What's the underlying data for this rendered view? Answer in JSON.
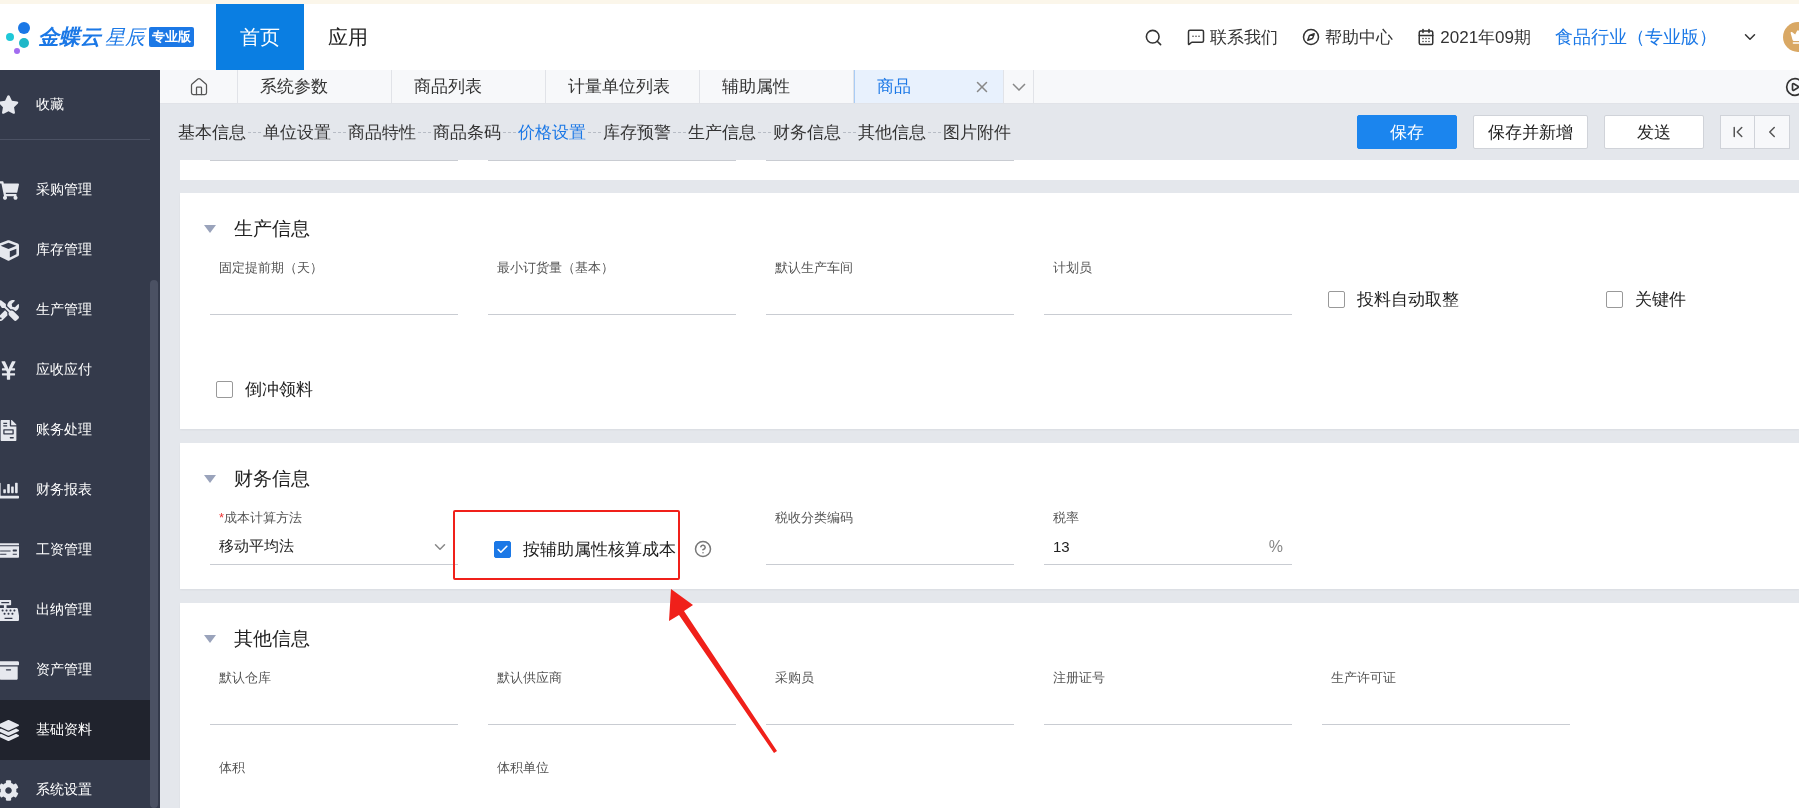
{
  "logo": {
    "brand": "金蝶云",
    "product": "星辰",
    "edition": "专业版"
  },
  "top_nav": [
    {
      "label": "首页",
      "selected": true
    },
    {
      "label": "应用",
      "selected": false
    }
  ],
  "header_actions": [
    {
      "label": "联系我们"
    },
    {
      "label": "帮助中心"
    },
    {
      "label": "2021年09期"
    }
  ],
  "account": {
    "label": "食品行业（专业版）"
  },
  "sidebar": {
    "items": [
      {
        "label": "收藏",
        "selected": false
      },
      {
        "label": "采购管理",
        "selected": false
      },
      {
        "label": "库存管理",
        "selected": false
      },
      {
        "label": "生产管理",
        "selected": false
      },
      {
        "label": "应收应付",
        "selected": false
      },
      {
        "label": "账务处理",
        "selected": false
      },
      {
        "label": "财务报表",
        "selected": false
      },
      {
        "label": "工资管理",
        "selected": false
      },
      {
        "label": "出纳管理",
        "selected": false
      },
      {
        "label": "资产管理",
        "selected": false
      },
      {
        "label": "基础资料",
        "selected": true
      },
      {
        "label": "系统设置",
        "selected": false
      }
    ]
  },
  "tabs": [
    {
      "label": "系统参数",
      "selected": false
    },
    {
      "label": "商品列表",
      "selected": false
    },
    {
      "label": "计量单位列表",
      "selected": false
    },
    {
      "label": "辅助属性",
      "selected": false
    },
    {
      "label": "商品",
      "selected": true
    }
  ],
  "anchors": [
    {
      "label": "基本信息",
      "selected": false
    },
    {
      "label": "单位设置",
      "selected": false
    },
    {
      "label": "商品特性",
      "selected": false
    },
    {
      "label": "商品条码",
      "selected": false
    },
    {
      "label": "价格设置",
      "selected": true
    },
    {
      "label": "库存预警",
      "selected": false
    },
    {
      "label": "生产信息",
      "selected": false
    },
    {
      "label": "财务信息",
      "selected": false
    },
    {
      "label": "其他信息",
      "selected": false
    },
    {
      "label": "图片附件",
      "selected": false
    }
  ],
  "actions": [
    {
      "label": "保存",
      "kind": "primary"
    },
    {
      "label": "保存并新增",
      "kind": "default"
    },
    {
      "label": "发送",
      "kind": "default"
    }
  ],
  "sections": [
    {
      "title": "生产信息",
      "expanded": true,
      "fields": [
        {
          "kind": "text",
          "label": "固定提前期（天）"
        },
        {
          "kind": "text",
          "label": "最小订货量（基本）"
        },
        {
          "kind": "text",
          "label": "默认生产车间"
        },
        {
          "kind": "text",
          "label": "计划员"
        },
        {
          "kind": "checkbox",
          "label": "投料自动取整",
          "checked": false
        },
        {
          "kind": "checkbox",
          "label": "关键件",
          "checked": false
        },
        {
          "kind": "checkbox",
          "label": "倒冲领料",
          "checked": false
        }
      ]
    },
    {
      "title": "财务信息",
      "expanded": true,
      "fields": [
        {
          "kind": "select",
          "label": "成本计算方法",
          "required_mark": "*",
          "value": "移动平均法"
        },
        {
          "kind": "checkbox",
          "label": "按辅助属性核算成本",
          "checked": true,
          "help": true,
          "annotated": true
        },
        {
          "kind": "text",
          "label": "税收分类编码"
        },
        {
          "kind": "text",
          "label": "税率",
          "value": "13",
          "suffix": "%"
        }
      ]
    },
    {
      "title": "其他信息",
      "expanded": true,
      "fields": [
        {
          "kind": "text",
          "label": "默认仓库"
        },
        {
          "kind": "text",
          "label": "默认供应商"
        },
        {
          "kind": "text",
          "label": "采购员"
        },
        {
          "kind": "text",
          "label": "注册证号"
        },
        {
          "kind": "text",
          "label": "生产许可证"
        },
        {
          "kind": "label",
          "label": "体积",
          "new_row": true
        },
        {
          "kind": "label",
          "label": "体积单位"
        }
      ]
    }
  ]
}
